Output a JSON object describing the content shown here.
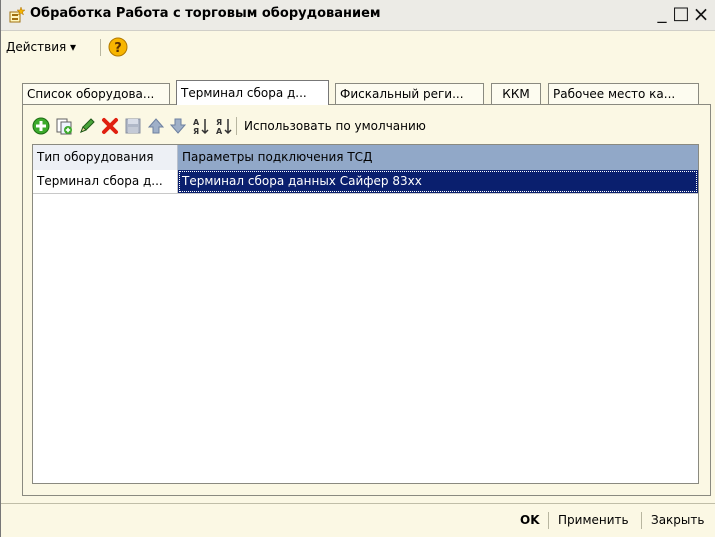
{
  "window": {
    "title": "Обработка  Работа с торговым оборудованием",
    "minimize": "_",
    "maximize": "□",
    "close": "×"
  },
  "menu": {
    "actions_label": "Действия ▾"
  },
  "tabs": [
    {
      "label": "Список оборудова..."
    },
    {
      "label": "Терминал сбора д..."
    },
    {
      "label": "Фискальный реги..."
    },
    {
      "label": "ККМ"
    },
    {
      "label": "Рабочее место ка..."
    }
  ],
  "toolbar": {
    "default_label": "Использовать по умолчанию"
  },
  "table": {
    "headers": [
      "Тип оборудования",
      "Параметры подключения ТСД"
    ],
    "rows": [
      [
        "Терминал сбора д...",
        "Терминал сбора данных Сайфер 83xx"
      ]
    ]
  },
  "footer": {
    "ok": "OK",
    "apply": "Применить",
    "close": "Закрыть"
  },
  "colors": {
    "header_left": "#edf0f5",
    "header_right": "#91a8c8",
    "selection": "#0a1f6e"
  }
}
